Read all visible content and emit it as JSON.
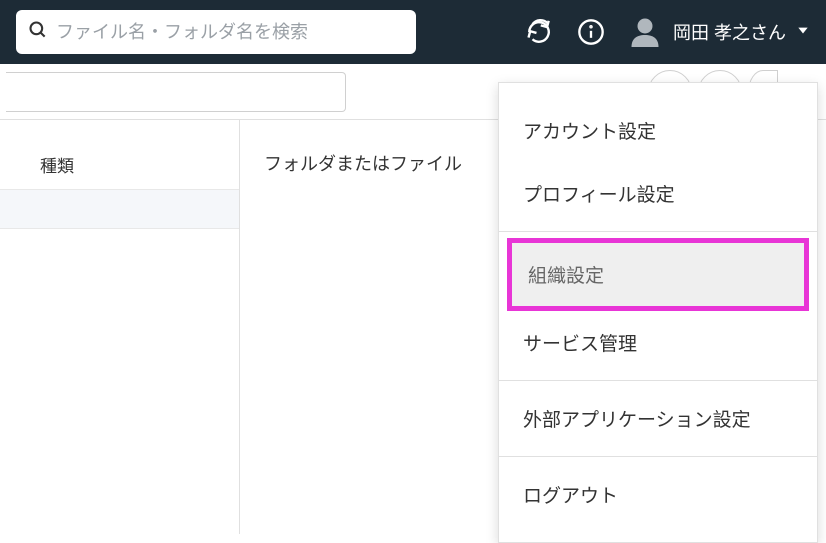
{
  "search": {
    "placeholder": "ファイル名・フォルダ名を検索"
  },
  "user": {
    "display_name": "岡田 孝之さん"
  },
  "sidebar": {
    "column_header": "種類"
  },
  "main": {
    "message": "フォルダまたはファイル"
  },
  "menu": {
    "items": [
      "アカウント設定",
      "プロフィール設定",
      "組織設定",
      "サービス管理",
      "外部アプリケーション設定",
      "ログアウト"
    ]
  },
  "icons": {
    "refresh": "refresh-icon",
    "info": "info-icon",
    "new_folder": "new-folder-icon",
    "cloud_upload": "cloud-upload-icon",
    "cloud_download": "cloud-download-icon"
  }
}
